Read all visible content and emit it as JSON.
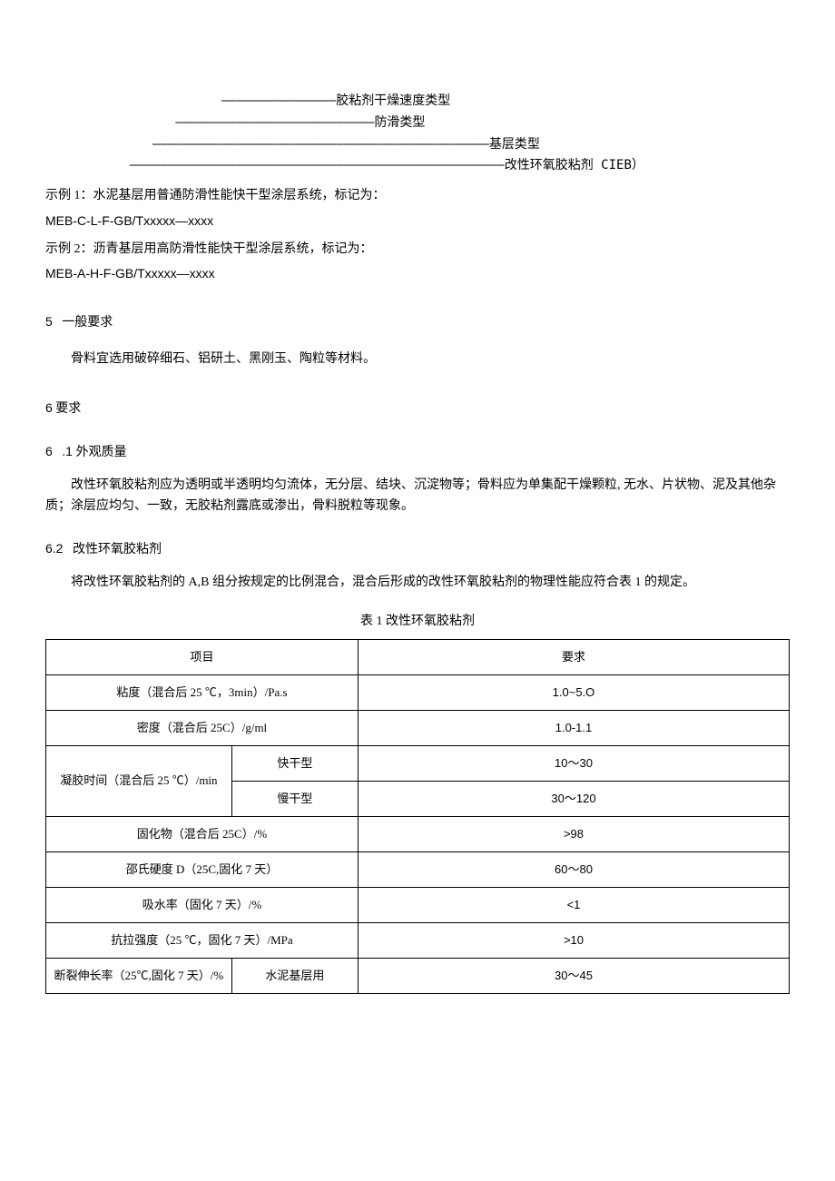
{
  "legend": {
    "l1": "胶粘剂干燥速度类型",
    "l2": "防滑类型",
    "l3": "基层类型",
    "l4": "改性环氧胶粘剂 CIEB）"
  },
  "examples": {
    "e1_label": "示例 1：水泥基层用普通防滑性能快干型涂层系统，标记为：",
    "e1_code": "MEB-C-L-F-GB/Txxxxx—xxxx",
    "e2_label": "示例 2：沥青基层用高防滑性能快干型涂层系统，标记为：",
    "e2_code": "MEB-A-H-F-GB/Txxxxx—xxxx"
  },
  "sec5": {
    "num": "5",
    "title": "一般要求",
    "body": "骨料宜选用破碎细石、铝研土、黑刚玉、陶粒等材料。"
  },
  "sec6": {
    "num": "6",
    "title": "要求"
  },
  "sec6_1": {
    "num": "6",
    "sub": ".1",
    "title": "外观质量",
    "body": "改性环氧胶粘剂应为透明或半透明均匀流体，无分层、结块、沉淀物等；骨料应为单集配干燥颗粒, 无水、片状物、泥及其他杂质；涂层应均匀、一致，无胶粘剂露底或渗出，骨料脱粒等现象。"
  },
  "sec6_2": {
    "num": "6.2",
    "title": "改性环氧胶粘剂",
    "body": "将改性环氧胶粘剂的 A,B 组分按规定的比例混合，混合后形成的改性环氧胶粘剂的物理性能应符合表 1 的规定。"
  },
  "table": {
    "caption": "表 1 改性环氧胶粘剂",
    "header": {
      "item": "项目",
      "req": "要求"
    },
    "rows": {
      "r1": {
        "item": "粘度（混合后 25 ℃，3min）/Pa.s",
        "req": "1.0~5.O"
      },
      "r2": {
        "item": "密度（混合后 25C）/g/ml",
        "req": "1.0-1.1"
      },
      "r3": {
        "item": "凝胶时间（混合后 25 ℃）/min",
        "sub1": "快干型",
        "req1": "10～30",
        "sub2": "慢干型",
        "req2": "30～120"
      },
      "r4": {
        "item": "固化物（混合后 25C）/%",
        "req": ">98"
      },
      "r5": {
        "item": "邵氏硬度 D（25C,固化 7 天）",
        "req": "60～80"
      },
      "r6": {
        "item": "吸水率（固化 7 天）/%",
        "req": "<1"
      },
      "r7": {
        "item": "抗拉强度（25 ℃，固化 7 天）/MPa",
        "req": ">10"
      },
      "r8": {
        "item": "断裂伸长率（25℃,固化 7 天）/%",
        "sub": "水泥基层用",
        "req": "30～45"
      }
    }
  }
}
